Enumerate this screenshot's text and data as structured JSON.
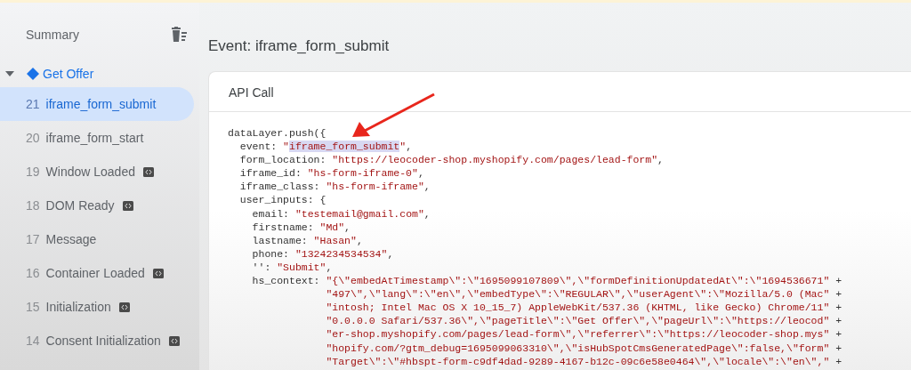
{
  "sidebar": {
    "title": "Summary",
    "group": {
      "label": "Get Offer",
      "expanded": true,
      "items": [
        {
          "number": "21",
          "label": "iframe_form_submit",
          "selected": true,
          "tagged": false
        },
        {
          "number": "20",
          "label": "iframe_form_start",
          "selected": false,
          "tagged": false
        },
        {
          "number": "19",
          "label": "Window Loaded",
          "selected": false,
          "tagged": true
        },
        {
          "number": "18",
          "label": "DOM Ready",
          "selected": false,
          "tagged": true
        },
        {
          "number": "17",
          "label": "Message",
          "selected": false,
          "tagged": false
        },
        {
          "number": "16",
          "label": "Container Loaded",
          "selected": false,
          "tagged": true
        },
        {
          "number": "15",
          "label": "Initialization",
          "selected": false,
          "tagged": true
        },
        {
          "number": "14",
          "label": "Consent Initialization",
          "selected": false,
          "tagged": true
        }
      ]
    }
  },
  "main": {
    "title": "Event: iframe_form_submit",
    "card": {
      "title": "API Call",
      "code": {
        "opening": "dataLayer.push({",
        "fields": [
          {
            "key": "event:",
            "lines": [
              [
                {
                  "text": "\"",
                  "kind": "string"
                },
                {
                  "text": "iframe_form_submit",
                  "kind": "highlight"
                },
                {
                  "text": "\"",
                  "kind": "string"
                },
                {
                  "text": ",",
                  "kind": "punct"
                }
              ]
            ]
          },
          {
            "key": "form_location:",
            "lines": [
              [
                {
                  "text": "\"https://leocoder-shop.myshopify.com/pages/lead-form\"",
                  "kind": "string"
                },
                {
                  "text": ",",
                  "kind": "punct"
                }
              ]
            ]
          },
          {
            "key": "iframe_id:",
            "lines": [
              [
                {
                  "text": "\"hs-form-iframe-0\"",
                  "kind": "string"
                },
                {
                  "text": ",",
                  "kind": "punct"
                }
              ]
            ]
          },
          {
            "key": "iframe_class:",
            "lines": [
              [
                {
                  "text": "\"hs-form-iframe\"",
                  "kind": "string"
                },
                {
                  "text": ",",
                  "kind": "punct"
                }
              ]
            ]
          },
          {
            "key": "user_inputs:",
            "lines": [
              [
                {
                  "text": "{",
                  "kind": "punct"
                }
              ]
            ],
            "children": [
              {
                "key": "email:",
                "lines": [
                  [
                    {
                      "text": "\"testemail@gmail.com\"",
                      "kind": "string"
                    },
                    {
                      "text": ",",
                      "kind": "punct"
                    }
                  ]
                ]
              },
              {
                "key": "firstname:",
                "lines": [
                  [
                    {
                      "text": "\"Md\"",
                      "kind": "string"
                    },
                    {
                      "text": ",",
                      "kind": "punct"
                    }
                  ]
                ]
              },
              {
                "key": "lastname:",
                "lines": [
                  [
                    {
                      "text": "\"Hasan\"",
                      "kind": "string"
                    },
                    {
                      "text": ",",
                      "kind": "punct"
                    }
                  ]
                ]
              },
              {
                "key": "phone:",
                "lines": [
                  [
                    {
                      "text": "\"1324234534534\"",
                      "kind": "string"
                    },
                    {
                      "text": ",",
                      "kind": "punct"
                    }
                  ]
                ]
              },
              {
                "key": "'':",
                "lines": [
                  [
                    {
                      "text": "\"Submit\"",
                      "kind": "string"
                    },
                    {
                      "text": ",",
                      "kind": "punct"
                    }
                  ]
                ]
              },
              {
                "key": "hs_context:",
                "lines": [
                  [
                    {
                      "text": "\"{\\\"embedAtTimestamp\\\":\\\"1695099107809\\\",\\\"formDefinitionUpdatedAt\\\":\\\"1694536671\"",
                      "kind": "string"
                    },
                    {
                      "text": " +",
                      "kind": "punct"
                    }
                  ],
                  [
                    {
                      "text": "\"497\\\",\\\"lang\\\":\\\"en\\\",\\\"embedType\\\":\\\"REGULAR\\\",\\\"userAgent\\\":\\\"Mozilla/5.0 (Mac\"",
                      "kind": "string"
                    },
                    {
                      "text": " +",
                      "kind": "punct"
                    }
                  ],
                  [
                    {
                      "text": "\"intosh; Intel Mac OS X 10_15_7) AppleWebKit/537.36 (KHTML, like Gecko) Chrome/11\"",
                      "kind": "string"
                    },
                    {
                      "text": " +",
                      "kind": "punct"
                    }
                  ],
                  [
                    {
                      "text": "\"0.0.0.0 Safari/537.36\\\",\\\"pageTitle\\\":\\\"Get Offer\\\",\\\"pageUrl\\\":\\\"https://leocod\"",
                      "kind": "string"
                    },
                    {
                      "text": " +",
                      "kind": "punct"
                    }
                  ],
                  [
                    {
                      "text": "\"er-shop.myshopify.com/pages/lead-form\\\",\\\"referrer\\\":\\\"https://leocoder-shop.mys\"",
                      "kind": "string"
                    },
                    {
                      "text": " +",
                      "kind": "punct"
                    }
                  ],
                  [
                    {
                      "text": "\"hopify.com/?gtm_debug=1695099063310\\\",\\\"isHubSpotCmsGeneratedPage\\\":false,\\\"form\"",
                      "kind": "string"
                    },
                    {
                      "text": " +",
                      "kind": "punct"
                    }
                  ],
                  [
                    {
                      "text": "\"Target\\\":\\\"#hbspt-form-c9df4dad-9289-4167-b12c-09c6e58e0464\\\",\\\"locale\\\":\\\"en\\\",\"",
                      "kind": "string"
                    },
                    {
                      "text": " +",
                      "kind": "punct"
                    }
                  ]
                ]
              }
            ]
          }
        ]
      }
    }
  }
}
